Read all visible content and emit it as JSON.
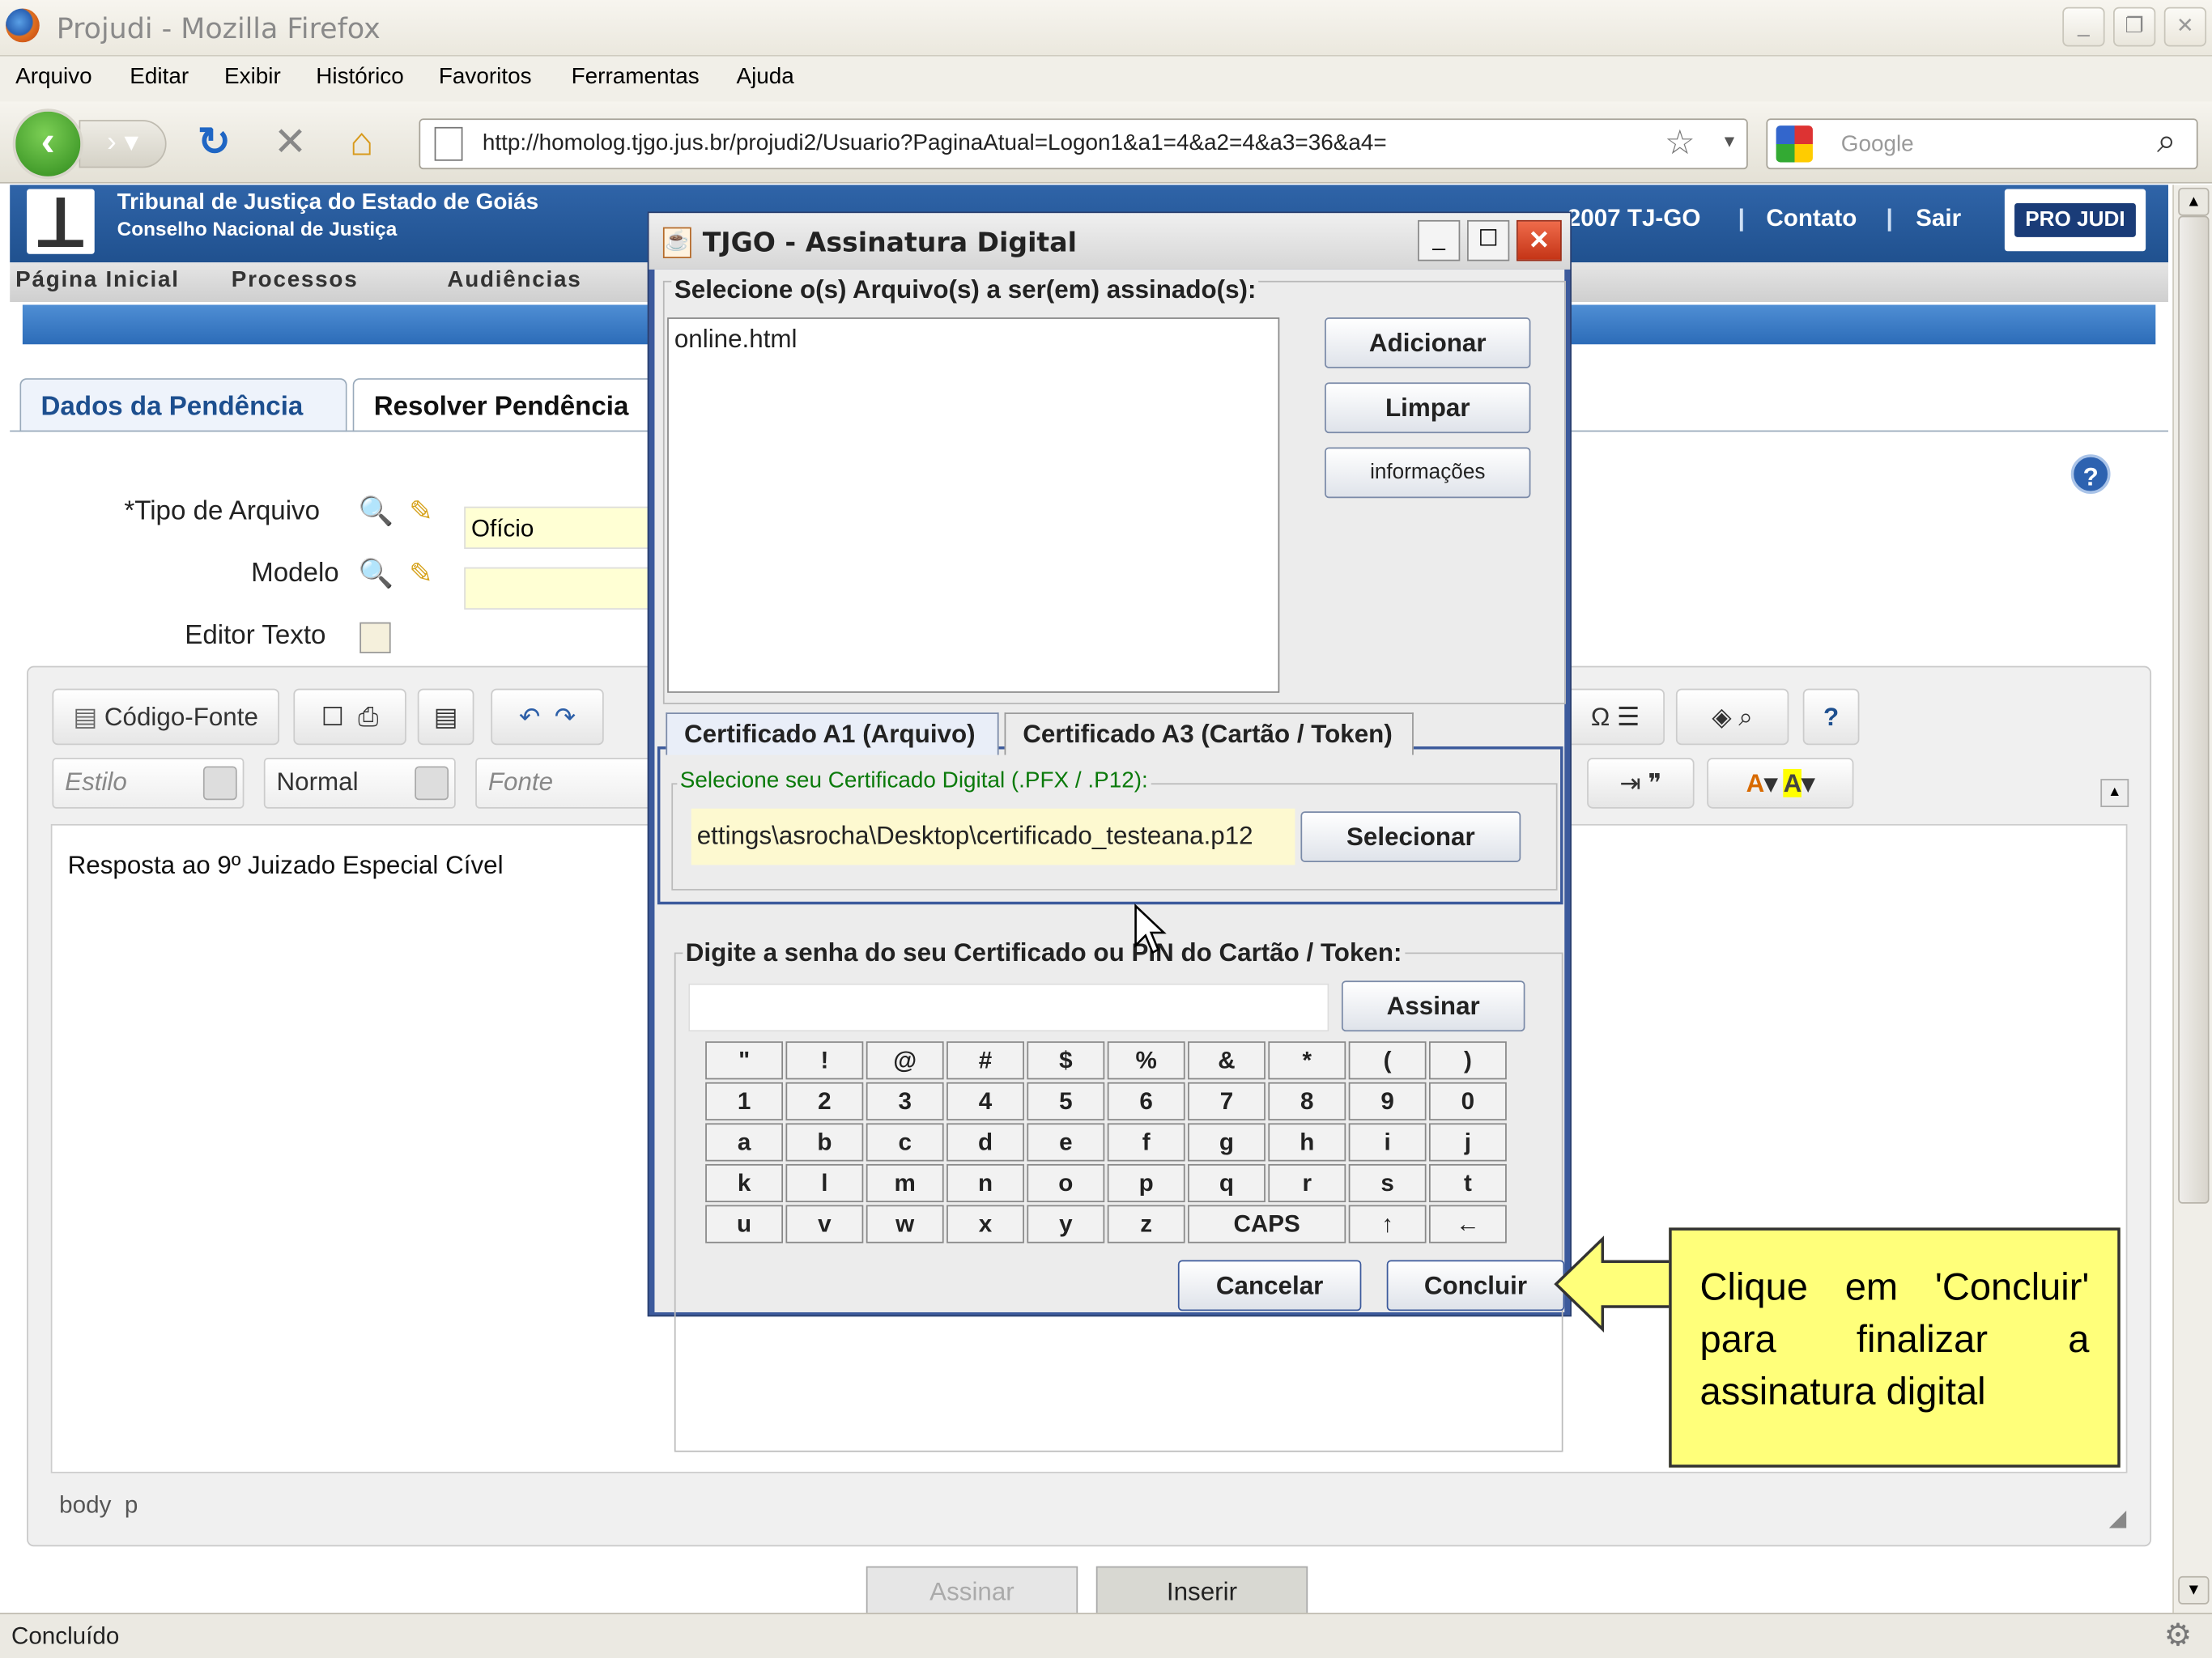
{
  "window": {
    "title": "Projudi - Mozilla Firefox"
  },
  "menu": [
    "Arquivo",
    "Editar",
    "Exibir",
    "Histórico",
    "Favoritos",
    "Ferramentas",
    "Ajuda"
  ],
  "nav": {
    "url": "http://homolog.tjgo.jus.br/projudi2/Usuario?PaginaAtual=Logon1&a1=4&a2=4&a3=36&a4=",
    "search_placeholder": "Google"
  },
  "site": {
    "title1": "Tribunal de Justiça do Estado de Goiás",
    "title2": "Conselho Nacional de Justiça",
    "copyright": "2007 TJ-GO",
    "contato": "Contato",
    "sair": "Sair",
    "logo": "PRO JUDI",
    "menu": [
      "Página Inicial",
      "Processos",
      "Audiências"
    ]
  },
  "tabs": [
    "Dados da Pendência",
    "Resolver Pendência"
  ],
  "form": {
    "tipo_label": "*Tipo de Arquivo",
    "tipo_value": "Ofício",
    "modelo_label": "Modelo",
    "editor_label": "Editor Texto"
  },
  "editor": {
    "source_btn": "Código-Fonte",
    "style": "Estilo",
    "format": "Normal",
    "font": "Fonte",
    "content": "Resposta ao 9º Juizado Especial Cível",
    "path": "body  p"
  },
  "page_buttons": {
    "assinar": "Assinar",
    "inserir": "Inserir"
  },
  "status": "Concluído",
  "dialog": {
    "title": "TJGO - Assinatura Digital",
    "files_label": "Selecione o(s) Arquivo(s) a ser(em) assinado(s):",
    "files": [
      "online.html"
    ],
    "btn_add": "Adicionar",
    "btn_clear": "Limpar",
    "btn_info": "informações",
    "tab_a1": "Certificado A1 (Arquivo)",
    "tab_a3": "Certificado A3 (Cartão / Token)",
    "cert_label": "Selecione seu Certificado Digital (.PFX / .P12):",
    "cert_path": "ettings\\asrocha\\Desktop\\certificado_testeana.p12",
    "btn_select": "Selecionar",
    "pwd_label": "Digite a senha do seu Certificado ou PIN do Cartão / Token:",
    "btn_sign": "Assinar",
    "keys": [
      [
        "\"",
        "!",
        "@",
        "#",
        "$",
        "%",
        "&",
        "*",
        "(",
        ")"
      ],
      [
        "1",
        "2",
        "3",
        "4",
        "5",
        "6",
        "7",
        "8",
        "9",
        "0"
      ],
      [
        "a",
        "b",
        "c",
        "d",
        "e",
        "f",
        "g",
        "h",
        "i",
        "j"
      ],
      [
        "k",
        "l",
        "m",
        "n",
        "o",
        "p",
        "q",
        "r",
        "s",
        "t"
      ],
      [
        "u",
        "v",
        "w",
        "x",
        "y",
        "z",
        "CAPS",
        "↑",
        "←"
      ]
    ],
    "btn_cancel": "Cancelar",
    "btn_finish": "Concluir"
  },
  "callout": "Clique em 'Concluir' para finalizar a assinatura digital"
}
